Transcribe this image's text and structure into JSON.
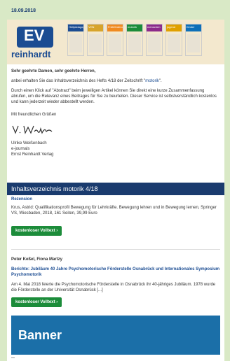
{
  "header": {
    "date": "18.09.2018",
    "logo_mark": "ΕV",
    "logo_text": "reinhardt",
    "covers": [
      {
        "label": "Heilpädagogik",
        "color": "#1b4c92"
      },
      {
        "label": "VHN",
        "color": "#d7a42b"
      },
      {
        "label": "Frühförderung",
        "color": "#f08a20"
      },
      {
        "label": "motorik",
        "color": "#1c8c3a"
      },
      {
        "label": "menschen",
        "color": "#8c2a8a"
      },
      {
        "label": "jugend",
        "color": "#e0a000"
      },
      {
        "label": "Kinder",
        "color": "#0d6fb8"
      }
    ]
  },
  "letter": {
    "salutation": "Sehr geehrte Damen, sehr geehrte Herren,",
    "p1_pre": "anbei erhalten Sie das Inhaltsverzeichnis des Hefts 4/18 der Zeitschrift \"",
    "p1_link": "motorik",
    "p1_post": "\".",
    "p2": "Durch einen Klick auf \"Abstract\" beim jeweiligen Artikel können Sie direkt eine kurze Zusammenfassung abrufen, um die Relevanz eines Beitrages für Sie zu beurteilen. Dieser Service ist selbstverständlich kostenlos und kann jederzeit wieder abbestellt werden.",
    "greeting": "Mit freundlichen Grüßen",
    "name": "Ulrike Weißenbach",
    "role": "e-journals",
    "company": "Ernst Reinhardt Verlag"
  },
  "toc_title": "Inhaltsverzeichnis motorik 4/18",
  "articles": [
    {
      "label": "Rezension",
      "text": "Krus, Astrid: Qualifikationsprofil Bewegung für Lehrkräfte. Bewegung lehren und in Bewegung lernen, Springer VS, Wiesbaden, 2018, 161 Seiten, 39,99 Euro",
      "button": "kostenloser Volltext ›"
    },
    {
      "author": "Peter Keßel, Fiona Martzy",
      "title": "Berichte: Jubiläum 40 Jahre Psychomotorische Förderstelle Osnabrück und Internationales Symposium Psychomotorik",
      "text": "Am 4. Mai 2018 feierte die Psychomotorische Förderstelle in Osnabrück ihr 40-jähriges Jubiläum. 1978 wurde die Förderstelle an der Universität Osnabrück [...]",
      "button": "kostenloser Volltext ›"
    }
  ],
  "banner": "Banner"
}
